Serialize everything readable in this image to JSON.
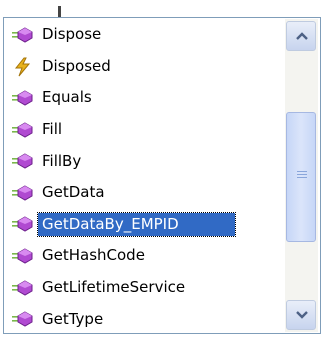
{
  "completion_list": {
    "items": [
      {
        "label": "Dispose",
        "kind": "method"
      },
      {
        "label": "Disposed",
        "kind": "event"
      },
      {
        "label": "Equals",
        "kind": "method"
      },
      {
        "label": "Fill",
        "kind": "method"
      },
      {
        "label": "FillBy",
        "kind": "method"
      },
      {
        "label": "GetData",
        "kind": "method"
      },
      {
        "label": "GetDataBy_EMPID",
        "kind": "method",
        "selected": true
      },
      {
        "label": "GetHashCode",
        "kind": "method"
      },
      {
        "label": "GetLifetimeService",
        "kind": "method"
      },
      {
        "label": "GetType",
        "kind": "method"
      }
    ]
  },
  "colors": {
    "selection": "#316ac5",
    "method_icon": "#b04ad1",
    "event_icon": "#e8b21b",
    "border": "#7f9db9"
  }
}
